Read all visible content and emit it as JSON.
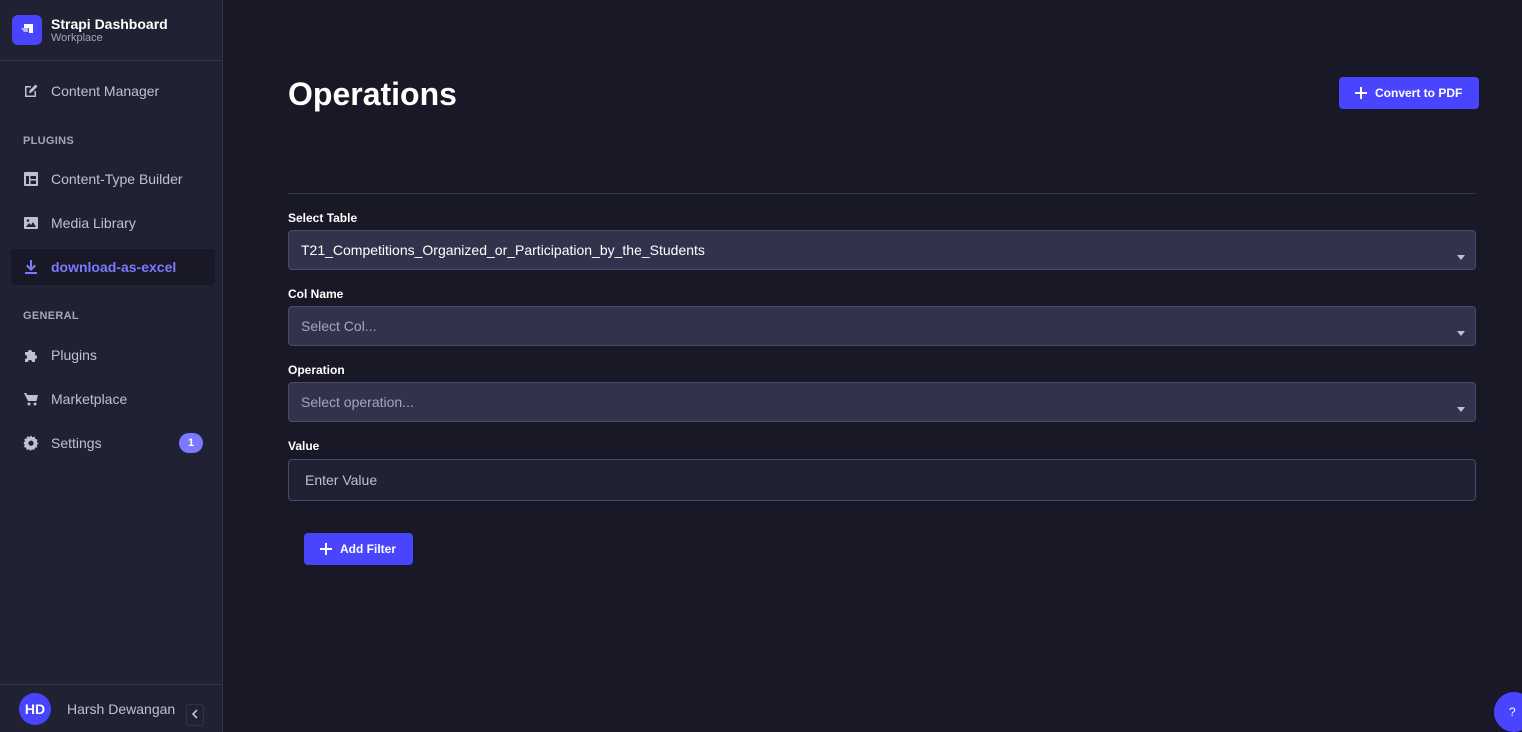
{
  "brand": {
    "title": "Strapi Dashboard",
    "subtitle": "Workplace"
  },
  "sidebar": {
    "items": [
      {
        "label": "Content Manager",
        "icon": "pencil-icon"
      },
      {
        "label": "Content-Type Builder",
        "icon": "layout-icon"
      },
      {
        "label": "Media Library",
        "icon": "image-icon"
      },
      {
        "label": "download-as-excel",
        "icon": "download-icon",
        "active": true
      },
      {
        "label": "Plugins",
        "icon": "puzzle-icon"
      },
      {
        "label": "Marketplace",
        "icon": "cart-icon"
      },
      {
        "label": "Settings",
        "icon": "gear-icon",
        "badge": "1"
      }
    ],
    "sections": {
      "plugins": "Plugins",
      "general": "General"
    }
  },
  "user": {
    "initials": "HD",
    "name": "Harsh Dewangan"
  },
  "main": {
    "title": "Operations",
    "convert_button": "Convert to PDF",
    "fields": {
      "table": {
        "label": "Select Table",
        "value": "T21_Competitions_Organized_or_Participation_by_the_Students"
      },
      "col": {
        "label": "Col Name",
        "placeholder": "Select Col..."
      },
      "operation": {
        "label": "Operation",
        "placeholder": "Select operation..."
      },
      "value": {
        "label": "Value",
        "placeholder": "Enter Value"
      }
    },
    "add_filter_button": "Add Filter"
  },
  "help": {
    "label": "?"
  },
  "colors": {
    "accent": "#4945ff",
    "accent_light": "#7b79ff",
    "background": "#181826",
    "sidebar": "#212134"
  }
}
